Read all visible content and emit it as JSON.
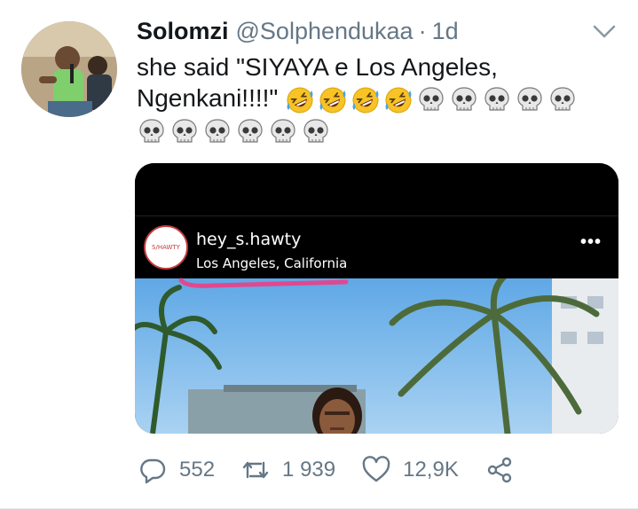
{
  "tweet": {
    "display_name": "Solomzi",
    "handle": "@Solphendukaa",
    "separator": "·",
    "time": "1d",
    "text": "she said \"SIYAYA e Los Angeles, Ngenkani!!!!\"",
    "emojis_line1": [
      "rolling-on-floor-laughing",
      "rolling-on-floor-laughing",
      "rolling-on-floor-laughing",
      "rolling-on-floor-laughing",
      "skull",
      "skull",
      "skull",
      "skull",
      "skull"
    ],
    "emojis_line2": [
      "skull",
      "skull",
      "skull",
      "skull",
      "skull",
      "skull"
    ]
  },
  "media": {
    "ig_username": "hey_s.hawty",
    "ig_location": "Los Angeles, California",
    "ig_avatar_text": "S/HAWTY",
    "ig_more": "•••",
    "underline_color": "#e0488f"
  },
  "actions": {
    "replies": "552",
    "retweets": "1 939",
    "likes": "12,9K"
  },
  "colors": {
    "text": "#14171a",
    "muted": "#657786",
    "icon": "#657786"
  },
  "icons": {
    "chevron": "chevron-down-icon",
    "reply": "reply-icon",
    "retweet": "retweet-icon",
    "like": "heart-icon",
    "share": "share-icon"
  }
}
